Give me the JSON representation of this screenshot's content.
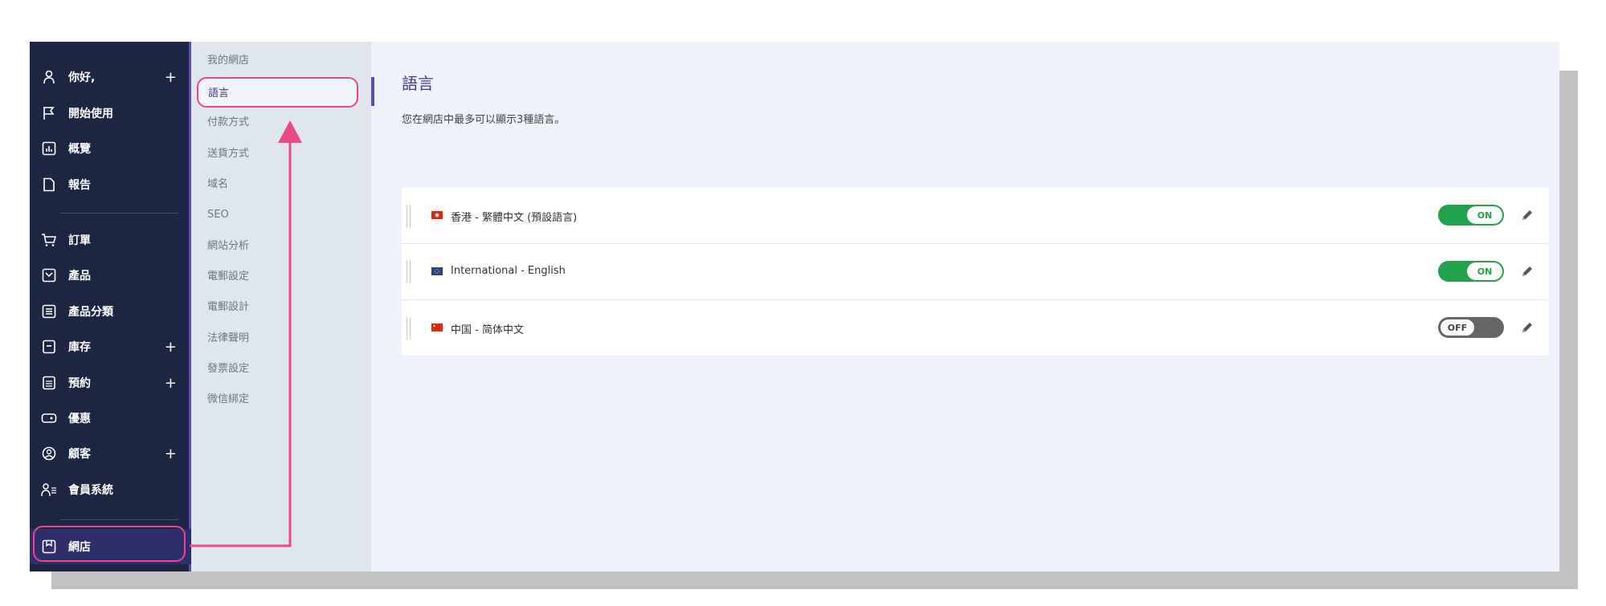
{
  "sidebar": {
    "items": [
      {
        "label": "你好,",
        "icon": "user-icon",
        "plus": "+"
      },
      {
        "label": "開始使用",
        "icon": "flag-icon",
        "plus": ""
      },
      {
        "label": "概覽",
        "icon": "chart-icon",
        "plus": ""
      },
      {
        "label": "報告",
        "icon": "document-icon",
        "plus": ""
      },
      {
        "label": "訂單",
        "icon": "cart-icon",
        "plus": ""
      },
      {
        "label": "產品",
        "icon": "product-icon",
        "plus": ""
      },
      {
        "label": "產品分類",
        "icon": "list-icon",
        "plus": ""
      },
      {
        "label": "庫存",
        "icon": "inventory-icon",
        "plus": "+"
      },
      {
        "label": "預約",
        "icon": "calendar-icon",
        "plus": "+"
      },
      {
        "label": "優惠",
        "icon": "coupon-icon",
        "plus": ""
      },
      {
        "label": "顧客",
        "icon": "customer-icon",
        "plus": "+"
      },
      {
        "label": "會員系統",
        "icon": "members-icon",
        "plus": ""
      },
      {
        "label": "網店",
        "icon": "store-icon",
        "plus": ""
      }
    ]
  },
  "submenu": {
    "items": [
      "我的網店",
      "語言",
      "付款方式",
      "送貨方式",
      "域名",
      "SEO",
      "網站分析",
      "電郵設定",
      "電郵設計",
      "法律聲明",
      "發票設定",
      "微信綁定"
    ]
  },
  "main": {
    "title": "語言",
    "description": "您在網店中最多可以顯示3種語言。",
    "languages": [
      {
        "name": "香港 - 繁體中文 (預設語言)",
        "status": "ON",
        "flag": "hk-flag"
      },
      {
        "name": "International - English",
        "status": "ON",
        "flag": "eu-flag"
      },
      {
        "name": "中国 - 简体中文",
        "status": "OFF",
        "flag": "cn-flag"
      }
    ]
  },
  "colors": {
    "sidebar_bg": "#1c2541",
    "accent": "#5a4fa8",
    "highlight": "#e84a86",
    "toggle_on": "#22a24a",
    "toggle_off": "#666666"
  }
}
